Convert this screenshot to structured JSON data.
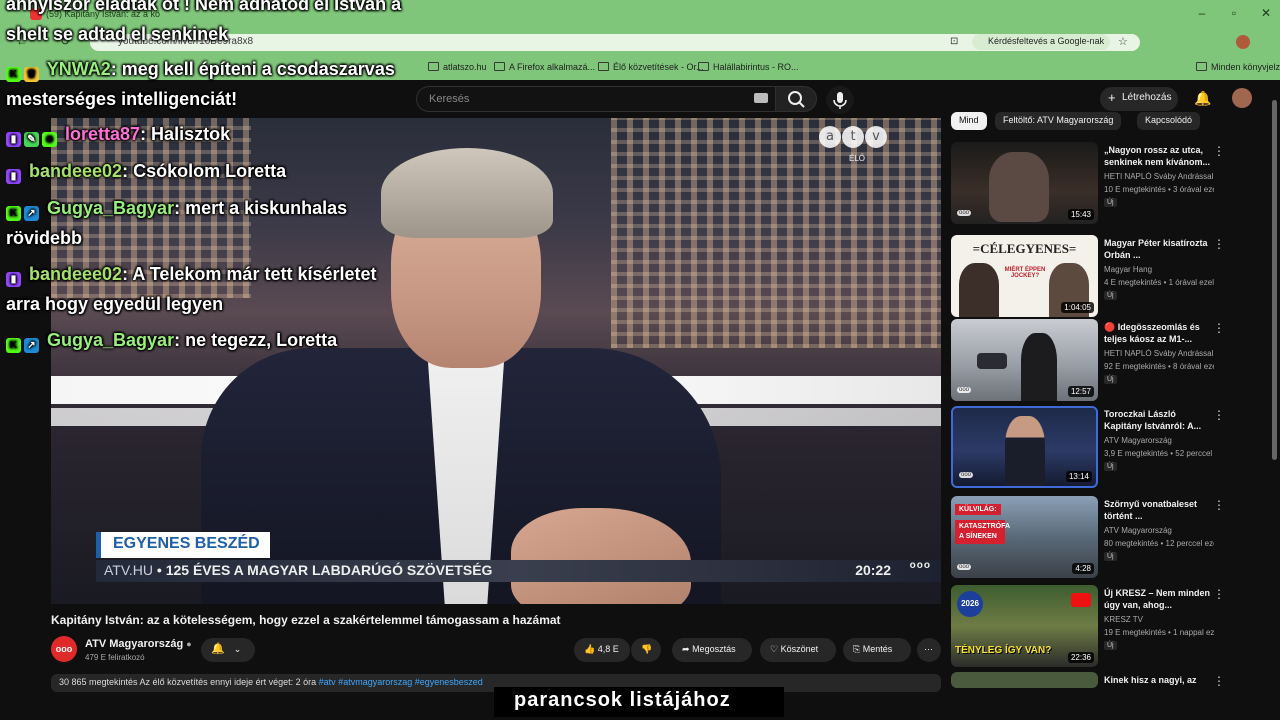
{
  "browser": {
    "tab_title": "(59) Kapitány István: az a kö",
    "url": "youtube.com/live/r10Be9ra8x8",
    "google_search_chip": "Kérdésfeltevés a Google-nak",
    "bookmarks": [
      "atlatszo.hu",
      "A Firefox alkalmazá...",
      "Élő közvetítések - Or...",
      "Halállabirintus - RO..."
    ],
    "bookmarks_other": "Minden könyvjelző"
  },
  "youtube": {
    "search_placeholder": "Keresés",
    "create_label": "Létrehozás",
    "video": {
      "title": "Kapitány István: az a kötelességem, hogy ezzel a szakértelemmel támogassam a hazámat",
      "channel": "ATV Magyarország",
      "subscribers": "479 E feliratkozó",
      "likes": "4,8 E",
      "share_label": "Megosztás",
      "thanks_label": "Köszönet",
      "save_label": "Mentés",
      "description": "30 865 megtekintés  Az élő közvetítés ennyi ideje ért véget: 2 óra",
      "tags": "#atv #atvmagyarorszag #egyenesbeszed",
      "overlay": {
        "atv_letters": [
          "a",
          "t",
          "v"
        ],
        "live_label": "ÉLŐ",
        "show_name": "EGYENES BESZÉD",
        "ticker_host": "ATV.HU",
        "ticker_text": "• 125 ÉVES A MAGYAR LABDARÚGÓ SZÖVETSÉG",
        "ticker_time": "20:22",
        "ticker_logo": "ooo"
      }
    },
    "chips": [
      "Mind",
      "Feltöltő: ATV Magyarország",
      "Kapcsolódó"
    ],
    "recommendations": [
      {
        "title": "„Nagyon rossz az utca, senkinek nem kívánom...",
        "channel": "HETI NAPLÓ Sváby Andrással",
        "meta": "10 E megtekintés • 3 órával ezelőtt",
        "duration": "15:43",
        "new": "Új"
      },
      {
        "title": "Magyar Péter kisatírozta Orbán ...",
        "channel": "Magyar Hang",
        "meta": "4 E megtekintés • 1 órával ezelőtt",
        "duration": "1:04:05",
        "new": "Új",
        "thumb_text": "=CÉLEGYENES=",
        "thumb_sub": "MIÉRT ÉPPEN JOCKEY?"
      },
      {
        "title": "🔴 Idegösszeomlás és teljes káosz az M1-...",
        "channel": "HETI NAPLÓ Sváby Andrással",
        "meta": "92 E megtekintés • 8 órával ezelőtt",
        "duration": "12:57",
        "new": "Új"
      },
      {
        "title": "Toroczkai László Kapitány Istvánról: A...",
        "channel": "ATV Magyarország",
        "meta": "3,9 E megtekintés • 52 perccel ezelőtt",
        "duration": "13:14",
        "new": "Új"
      },
      {
        "title": "Szörnyű vonatbaleset történt ...",
        "channel": "ATV Magyarország",
        "meta": "80 megtekintés • 12 perccel ezelőtt",
        "duration": "4:28",
        "new": "Új",
        "thumb_text": "KÜLVILÁG:",
        "thumb_sub": "KATASZTRÓFA A SÍNEKEN"
      },
      {
        "title": "Új KRESZ – Nem minden úgy van, ahog...",
        "channel": "KRESZ TV",
        "meta": "19 E megtekintés • 1 nappal ezelőtt",
        "duration": "22:36",
        "new": "Új",
        "thumb_text": "2026",
        "thumb_sub": "TÉNYLEG ÍGY VAN?"
      },
      {
        "title": "Kinek hisz a nagyi, az",
        "channel": "",
        "meta": "",
        "duration": "",
        "new": ""
      }
    ]
  },
  "stream_chat": [
    {
      "text": "annyiszor eladták őt ! Nem adnátod el István a"
    },
    {
      "text": "shelt se adtad el senkinek"
    },
    {
      "user": "YNWA2",
      "text": ": meg kell építeni a csodaszarvas"
    },
    {
      "text": "mesterséges intelligenciát!"
    },
    {
      "user": "loretta87",
      "text": ": Halisztok"
    },
    {
      "user": "bandeee02",
      "text": ": Csókolom Loretta"
    },
    {
      "user": "Gugya_Bagyar",
      "text": ": mert a kiskunhalas"
    },
    {
      "text": "rövidebb"
    },
    {
      "user": "bandeee02",
      "text": ": A Telekom már tett kísérletet"
    },
    {
      "text": "arra hogy egyedül legyen"
    },
    {
      "user": "Gugya_Bagyar",
      "text": ": ne tegezz, Loretta"
    }
  ],
  "caption": "parancsok listájához",
  "colors": {
    "browser_frame": "#7fc67a",
    "yt_bg": "#0f0f0f",
    "channel_red": "#e02a2a",
    "twitch": "#9146ff",
    "kick": "#53fc18"
  }
}
